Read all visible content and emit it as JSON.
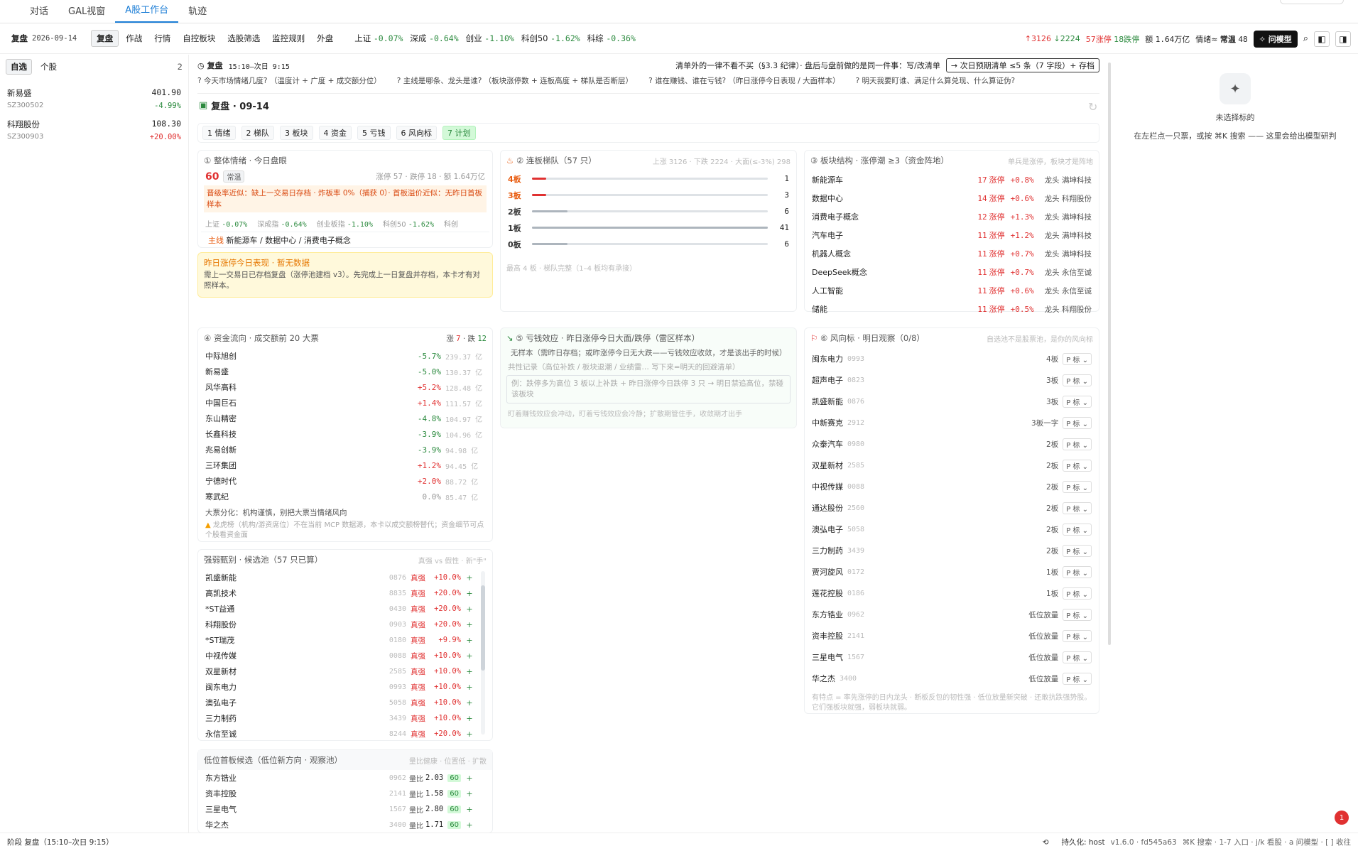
{
  "topnav": {
    "tabs": [
      "对话",
      "GAL视窗",
      "A股工作台",
      "轨迹"
    ]
  },
  "bar2": {
    "mode": "复盘",
    "date": "2026-09-14",
    "buttons": [
      "复盘",
      "作战",
      "行情",
      "自控板块",
      "选股筛选",
      "监控规则",
      "外盘"
    ],
    "indexes": [
      {
        "n": "上证",
        "v": "-0.07%"
      },
      {
        "n": "深成",
        "v": "-0.64%"
      },
      {
        "n": "创业",
        "v": "-1.10%"
      },
      {
        "n": "科创50",
        "v": "-1.62%"
      },
      {
        "n": "科综",
        "v": "-0.36%"
      }
    ],
    "up": "↑3126",
    "down": "↓2224",
    "limit_up": "57涨停",
    "limit_down": "18跌停",
    "amount_label": "额",
    "amount": "1.64万亿",
    "mood_label": "情绪≈",
    "mood": "常温",
    "mood_val": "48",
    "ask": "问模型"
  },
  "left": {
    "tabs": [
      "自选",
      "个股"
    ],
    "count": "2",
    "items": [
      {
        "name": "新易盛",
        "code": "SZ300502",
        "price": "401.90",
        "chg": "-4.99%"
      },
      {
        "name": "科翔股份",
        "code": "SZ300903",
        "price": "108.30",
        "chg": "+20.00%"
      }
    ]
  },
  "header": {
    "title": "复盘",
    "time": "15:10–次日 9:15",
    "note": "清单外的一律不看不买（§3.3 纪律）· 盘后与盘前做的是同一件事：写/改清单",
    "btn": "→ 次日预期清单 ≤5 条（7 字段）+ 存档",
    "qs": [
      "? 今天市场情绪几度? （温度计 + 广度 + 成交额分位）",
      "? 主线是哪条、龙头是谁? （板块涨停数 + 连板高度 + 梯队是否断层）",
      "? 谁在赚钱、谁在亏钱? （昨日涨停今日表现 / 大面样本）",
      "? 明天我要盯谁、满足什么算兑现、什么算证伪?"
    ]
  },
  "review": {
    "title": "复盘 · 09-14",
    "steps": [
      "1 情绪",
      "2 梯队",
      "3 板块",
      "4 资金",
      "5 亏钱",
      "6 风向标",
      "7 计划"
    ]
  },
  "mood": {
    "title": "① 整体情绪 · 今日盘眼",
    "score": "60",
    "level": "常温",
    "stats": "涨停 57 · 跌停 18 · 额 1.64万亿",
    "warn": "晋级率近似：缺上一交易日存档 · 炸板率 0%（捕获 0）· 首板溢价近似：无昨日首板样本",
    "idx": [
      {
        "n": "上证",
        "v": "-0.07%"
      },
      {
        "n": "深成指",
        "v": "-0.64%"
      },
      {
        "n": "创业板指",
        "v": "-1.10%"
      },
      {
        "n": "科创50",
        "v": "-1.62%"
      },
      {
        "n": "科创",
        "v": ""
      }
    ],
    "main_label": "主线",
    "main": "新能源车 / 数据中心 / 消费电子概念",
    "y_title": "昨日涨停今日表现 · 暂无数据",
    "y_text": "需上一交易日已存档复盘（涨停池建档 v3）。先完成上一日复盘并存档，本卡才有对照样本。"
  },
  "ladder": {
    "title": "② 连板梯队（57 只）",
    "sub": "上涨 3126 · 下跌 2224 · 大面(≤-3%) 298",
    "foot": "最高 4 板 · 梯队完整（1–4 板均有承接）",
    "rows": [
      {
        "l": "4板",
        "n": "1",
        "f": 0.06,
        "c": "#e03131",
        "lc": "#e8590c"
      },
      {
        "l": "3板",
        "n": "3",
        "f": 0.06,
        "c": "#e03131",
        "lc": "#e8590c"
      },
      {
        "l": "2板",
        "n": "6",
        "f": 0.15,
        "c": "#adb5bd",
        "lc": "#333"
      },
      {
        "l": "1板",
        "n": "41",
        "f": 1.0,
        "c": "#adb5bd",
        "lc": "#333"
      },
      {
        "l": "0板",
        "n": "6",
        "f": 0.15,
        "c": "#adb5bd",
        "lc": "#333"
      }
    ]
  },
  "sectors": {
    "title": "③ 板块结构 · 涨停潮 ≥3（资金阵地）",
    "sub": "单兵是涨停，板块才是阵地",
    "rows": [
      {
        "n": "新能源车",
        "lu": "17",
        "u": "涨停",
        "p": "+0.8%",
        "d": "龙头 满坤科技"
      },
      {
        "n": "数据中心",
        "lu": "14",
        "u": "涨停",
        "p": "+0.6%",
        "d": "龙头 科翔股份"
      },
      {
        "n": "消费电子概念",
        "lu": "12",
        "u": "涨停",
        "p": "+1.3%",
        "d": "龙头 满坤科技"
      },
      {
        "n": "汽车电子",
        "lu": "11",
        "u": "涨停",
        "p": "+1.2%",
        "d": "龙头 满坤科技"
      },
      {
        "n": "机器人概念",
        "lu": "11",
        "u": "涨停",
        "p": "+0.7%",
        "d": "龙头 满坤科技"
      },
      {
        "n": "DeepSeek概念",
        "lu": "11",
        "u": "涨停",
        "p": "+0.7%",
        "d": "龙头 永信至诚"
      },
      {
        "n": "人工智能",
        "lu": "11",
        "u": "涨停",
        "p": "+0.6%",
        "d": "龙头 永信至诚"
      },
      {
        "n": "储能",
        "lu": "11",
        "u": "涨停",
        "p": "+0.5%",
        "d": "龙头 科翔股份"
      }
    ]
  },
  "funds": {
    "title": "④ 资金流向 · 成交额前 20 大票",
    "up_l": "涨",
    "up": "7",
    "dn_l": "跌",
    "dn": "12",
    "rows": [
      {
        "n": "中际旭创",
        "p": "-5.7%",
        "a": "239.37 亿"
      },
      {
        "n": "新易盛",
        "p": "-5.0%",
        "a": "130.37 亿"
      },
      {
        "n": "风华高科",
        "p": "+5.2%",
        "a": "128.48 亿"
      },
      {
        "n": "中国巨石",
        "p": "+1.4%",
        "a": "111.57 亿"
      },
      {
        "n": "东山精密",
        "p": "-4.8%",
        "a": "104.97 亿"
      },
      {
        "n": "长鑫科技",
        "p": "-3.9%",
        "a": "104.96 亿"
      },
      {
        "n": "兆易创新",
        "p": "-3.9%",
        "a": "94.98 亿"
      },
      {
        "n": "三环集团",
        "p": "+1.2%",
        "a": "94.45 亿"
      },
      {
        "n": "宁德时代",
        "p": "+2.0%",
        "a": "88.72 亿"
      },
      {
        "n": "寒武纪",
        "p": "0.0%",
        "a": "85.47 亿"
      }
    ],
    "note": "大票分化：机构谨慎，别把大票当情绪风向",
    "warn": "龙虎榜（机构/游资席位）不在当前 MCP 数据源，本卡以成交额榜替代；资金细节可点个股看资金面"
  },
  "loss": {
    "title": "⑤ 亏钱效应 · 昨日涨停今日大面/跌停（雷区样本）",
    "text": "无样本（需昨日存档；或昨涨停今日无大跌——亏钱效应收敛，才是该出手的时候）",
    "rec": "共性记录（高位补跌 / 板块退潮 / 业绩雷… 写下来=明天的回避清单）",
    "ph": "例：跌停多为高位 3 板以上补跌 + 昨日涨停今日跌停 3 只 → 明日禁追高位，禁碰该板块",
    "foot": "盯着赚钱效应会冲动，盯着亏钱效应会冷静；扩散期管住手，收敛期才出手"
  },
  "vanes": {
    "title": "⑥ 风向标 · 明日观察（0/8）",
    "sub": "自选池不是股票池，是你的风向标",
    "tag": "P 标",
    "rows": [
      {
        "n": "闽东电力",
        "c": "0993",
        "b": "4板"
      },
      {
        "n": "超声电子",
        "c": "0823",
        "b": "3板"
      },
      {
        "n": "凯盛新能",
        "c": "0876",
        "b": "3板"
      },
      {
        "n": "中新赛克",
        "c": "2912",
        "b": "3板一字"
      },
      {
        "n": "众泰汽车",
        "c": "0980",
        "b": "2板"
      },
      {
        "n": "双星新材",
        "c": "2585",
        "b": "2板"
      },
      {
        "n": "中视传媒",
        "c": "0088",
        "b": "2板"
      },
      {
        "n": "通达股份",
        "c": "2560",
        "b": "2板"
      },
      {
        "n": "澳弘电子",
        "c": "5058",
        "b": "2板"
      },
      {
        "n": "三力制药",
        "c": "3439",
        "b": "2板"
      },
      {
        "n": "贾河旋风",
        "c": "0172",
        "b": "1板"
      },
      {
        "n": "莲花控股",
        "c": "0186",
        "b": "1板"
      },
      {
        "n": "东方锆业",
        "c": "0962",
        "b": "低位放量"
      },
      {
        "n": "资丰控股",
        "c": "2141",
        "b": "低位放量"
      },
      {
        "n": "三星电气",
        "c": "1567",
        "b": "低位放量"
      },
      {
        "n": "华之杰",
        "c": "3400",
        "b": "低位放量"
      }
    ],
    "foot": "有特点 = 率先涨停的日内龙头 · 断板反包的韧性强 · 低位放量新突破 · 还敢抗跌强势股。它们强板块就强，弱板块就弱。"
  },
  "strong": {
    "title": "强弱甄别 · 候选池（57 只已算）",
    "sub": "真强 vs 假性 · 新\"手\"",
    "rows": [
      {
        "n": "凯盛新能",
        "c": "0876",
        "t": "真强",
        "p": "+10.0%"
      },
      {
        "n": "高凯技术",
        "c": "8835",
        "t": "真强",
        "p": "+20.0%"
      },
      {
        "n": "*ST益通",
        "c": "0430",
        "t": "真强",
        "p": "+20.0%"
      },
      {
        "n": "科翔股份",
        "c": "0903",
        "t": "真强",
        "p": "+20.0%"
      },
      {
        "n": "*ST瑞茂",
        "c": "0180",
        "t": "真强",
        "p": "+9.9%"
      },
      {
        "n": "中视传媒",
        "c": "0088",
        "t": "真强",
        "p": "+10.0%"
      },
      {
        "n": "双星新材",
        "c": "2585",
        "t": "真强",
        "p": "+10.0%"
      },
      {
        "n": "闽东电力",
        "c": "0993",
        "t": "真强",
        "p": "+10.0%"
      },
      {
        "n": "澳弘电子",
        "c": "5058",
        "t": "真强",
        "p": "+10.0%"
      },
      {
        "n": "三力制药",
        "c": "3439",
        "t": "真强",
        "p": "+10.0%"
      },
      {
        "n": "永信至诚",
        "c": "8244",
        "t": "真强",
        "p": "+20.0%"
      }
    ]
  },
  "lowpos": {
    "title": "低位首板候选（低位新方向 · 观察池）",
    "sub": "量比健康 · 位置低 · 扩散",
    "rows": [
      {
        "n": "东方锆业",
        "c": "0962",
        "r": "2.03",
        "s": "60"
      },
      {
        "n": "资丰控股",
        "c": "2141",
        "r": "1.58",
        "s": "60"
      },
      {
        "n": "三星电气",
        "c": "1567",
        "r": "2.80",
        "s": "60"
      },
      {
        "n": "华之杰",
        "c": "3400",
        "r": "1.71",
        "s": "60"
      }
    ],
    "ratio_label": "量比"
  },
  "right": {
    "t1": "未选择标的",
    "t2": "在左栏点一只票，或按 ⌘K 搜索 —— 这里会给出模型研判"
  },
  "footer": {
    "phase": "阶段 复盘（15:10–次日 9:15）",
    "persist": "持久化: host",
    "ver": "v1.6.0 · fd545a63",
    "keys": "⌘K 搜索 · 1-7 入口 · j/k 看股 · a 问模型 · [ ] 收往",
    "badge": "1"
  }
}
